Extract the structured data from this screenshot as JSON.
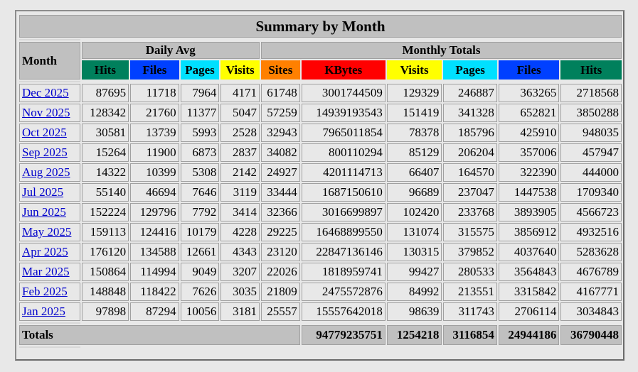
{
  "title": "Summary by Month",
  "headers": {
    "month": "Month",
    "daily_avg": "Daily Avg",
    "monthly_totals": "Monthly Totals",
    "daily_cols": [
      "Hits",
      "Files",
      "Pages",
      "Visits"
    ],
    "monthly_cols": [
      "Sites",
      "KBytes",
      "Visits",
      "Pages",
      "Files",
      "Hits"
    ]
  },
  "rows": [
    {
      "month": "Dec 2025",
      "d_hits": "87695",
      "d_files": "11718",
      "d_pages": "7964",
      "d_visits": "4171",
      "sites": "61748",
      "kbytes": "3001744509",
      "visits": "129329",
      "pages": "246887",
      "files": "363265",
      "hits": "2718568"
    },
    {
      "month": "Nov 2025",
      "d_hits": "128342",
      "d_files": "21760",
      "d_pages": "11377",
      "d_visits": "5047",
      "sites": "57259",
      "kbytes": "14939193543",
      "visits": "151419",
      "pages": "341328",
      "files": "652821",
      "hits": "3850288"
    },
    {
      "month": "Oct 2025",
      "d_hits": "30581",
      "d_files": "13739",
      "d_pages": "5993",
      "d_visits": "2528",
      "sites": "32943",
      "kbytes": "7965011854",
      "visits": "78378",
      "pages": "185796",
      "files": "425910",
      "hits": "948035"
    },
    {
      "month": "Sep 2025",
      "d_hits": "15264",
      "d_files": "11900",
      "d_pages": "6873",
      "d_visits": "2837",
      "sites": "34082",
      "kbytes": "800110294",
      "visits": "85129",
      "pages": "206204",
      "files": "357006",
      "hits": "457947"
    },
    {
      "month": "Aug 2025",
      "d_hits": "14322",
      "d_files": "10399",
      "d_pages": "5308",
      "d_visits": "2142",
      "sites": "24927",
      "kbytes": "4201114713",
      "visits": "66407",
      "pages": "164570",
      "files": "322390",
      "hits": "444000"
    },
    {
      "month": "Jul 2025",
      "d_hits": "55140",
      "d_files": "46694",
      "d_pages": "7646",
      "d_visits": "3119",
      "sites": "33444",
      "kbytes": "1687150610",
      "visits": "96689",
      "pages": "237047",
      "files": "1447538",
      "hits": "1709340"
    },
    {
      "month": "Jun 2025",
      "d_hits": "152224",
      "d_files": "129796",
      "d_pages": "7792",
      "d_visits": "3414",
      "sites": "32366",
      "kbytes": "3016699897",
      "visits": "102420",
      "pages": "233768",
      "files": "3893905",
      "hits": "4566723"
    },
    {
      "month": "May 2025",
      "d_hits": "159113",
      "d_files": "124416",
      "d_pages": "10179",
      "d_visits": "4228",
      "sites": "29225",
      "kbytes": "16468899550",
      "visits": "131074",
      "pages": "315575",
      "files": "3856912",
      "hits": "4932516"
    },
    {
      "month": "Apr 2025",
      "d_hits": "176120",
      "d_files": "134588",
      "d_pages": "12661",
      "d_visits": "4343",
      "sites": "23120",
      "kbytes": "22847136146",
      "visits": "130315",
      "pages": "379852",
      "files": "4037640",
      "hits": "5283628"
    },
    {
      "month": "Mar 2025",
      "d_hits": "150864",
      "d_files": "114994",
      "d_pages": "9049",
      "d_visits": "3207",
      "sites": "22026",
      "kbytes": "1818959741",
      "visits": "99427",
      "pages": "280533",
      "files": "3564843",
      "hits": "4676789"
    },
    {
      "month": "Feb 2025",
      "d_hits": "148848",
      "d_files": "118422",
      "d_pages": "7626",
      "d_visits": "3035",
      "sites": "21809",
      "kbytes": "2475572876",
      "visits": "84992",
      "pages": "213551",
      "files": "3315842",
      "hits": "4167771"
    },
    {
      "month": "Jan 2025",
      "d_hits": "97898",
      "d_files": "87294",
      "d_pages": "10056",
      "d_visits": "3181",
      "sites": "25557",
      "kbytes": "15557642018",
      "visits": "98639",
      "pages": "311743",
      "files": "2706114",
      "hits": "3034843"
    }
  ],
  "totals": {
    "label": "Totals",
    "kbytes": "94779235751",
    "visits": "1254218",
    "pages": "3116854",
    "files": "24944186",
    "hits": "36790448"
  }
}
